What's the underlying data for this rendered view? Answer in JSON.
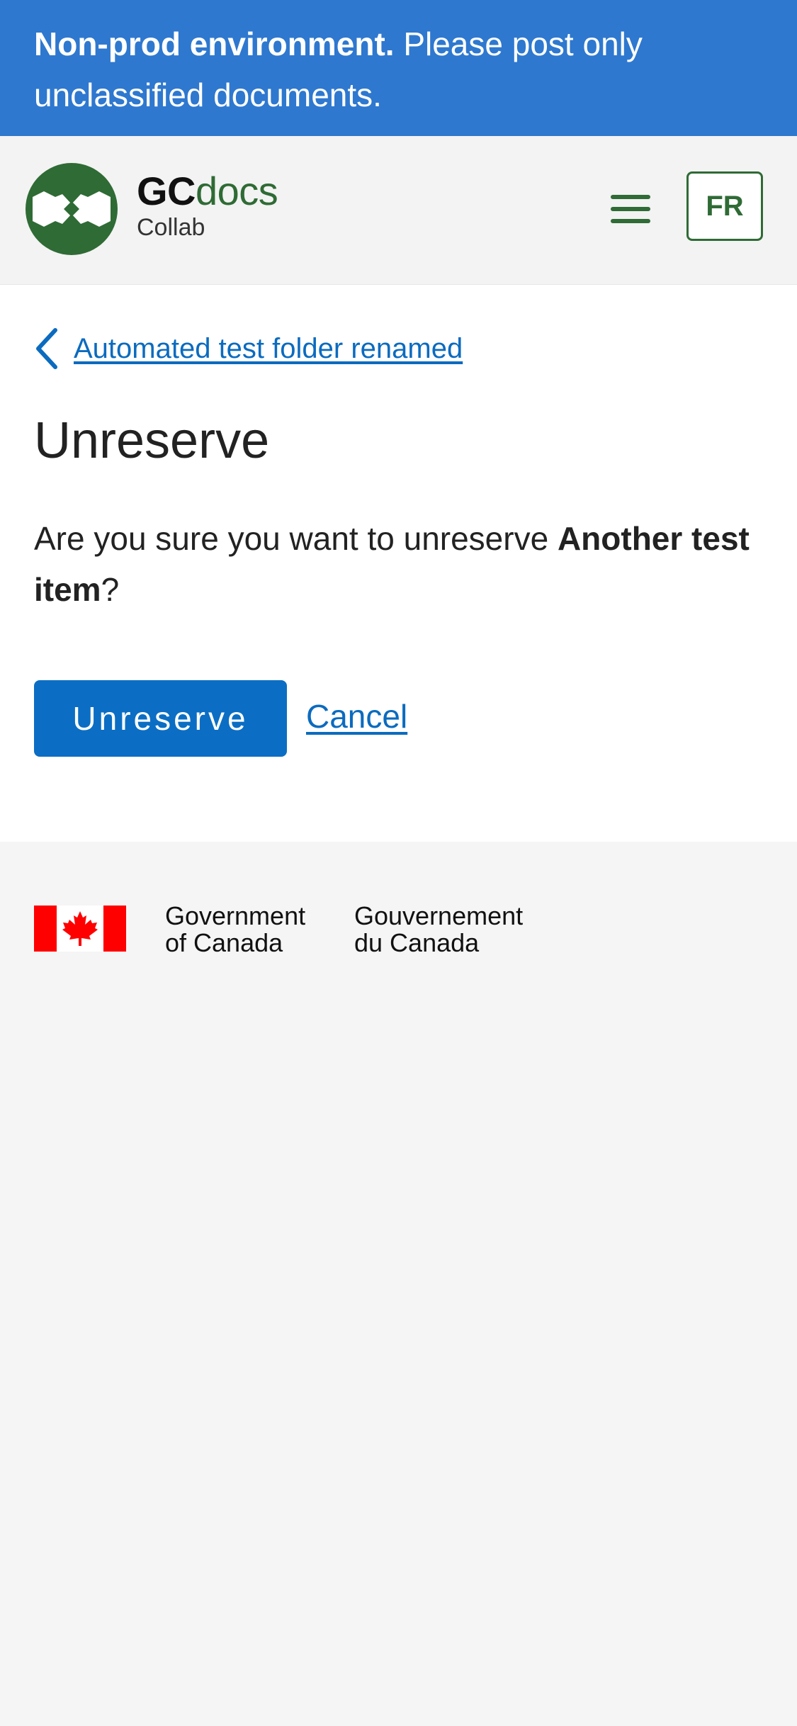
{
  "banner": {
    "bold": "Non-prod environment.",
    "line1_rest": " Please post only",
    "line2": "unclassified documents."
  },
  "header": {
    "brand_gc": "GC",
    "brand_docs": "docs",
    "brand_sub": "Collab",
    "menu_icon": "hamburger-menu-icon",
    "lang_label": "FR",
    "brand_color": "#2f6b35"
  },
  "main": {
    "back_link": "Automated test folder renamed",
    "back_icon": "chevron-left-icon",
    "title": "Unreserve",
    "confirm_prefix": "Are you sure you want to unreserve ",
    "item_name": "Another test item",
    "confirm_suffix": "?",
    "primary_button": "Unreserve",
    "cancel_link": "Cancel",
    "accent_color": "#0b6ec4"
  },
  "footer": {
    "flag_icon": "canada-flag-icon",
    "gov_en_line1": "Government",
    "gov_en_line2": "of Canada",
    "gov_fr_line1": "Gouvernement",
    "gov_fr_line2": "du Canada"
  }
}
